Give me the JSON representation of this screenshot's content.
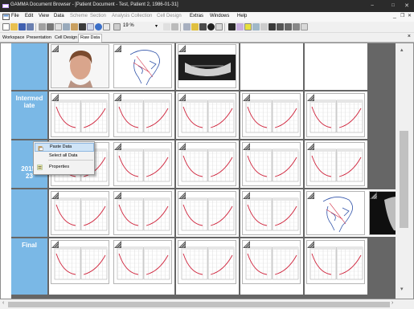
{
  "window": {
    "title": "GAMMA Document Browser - [Patient Document - Test, Patient 2, 1986-01-31]",
    "minimize": "−",
    "maximize": "□",
    "close": "✕"
  },
  "menu": {
    "items": [
      {
        "label": "File",
        "enabled": true
      },
      {
        "label": "Edit",
        "enabled": true
      },
      {
        "label": "View",
        "enabled": true
      },
      {
        "label": "Data",
        "enabled": true
      },
      {
        "label": "Scheme",
        "enabled": false
      },
      {
        "label": "Section",
        "enabled": false
      },
      {
        "label": "Analysis Collection",
        "enabled": false
      },
      {
        "label": "Cell Design",
        "enabled": false
      },
      {
        "label": "Extras",
        "enabled": true
      },
      {
        "label": "Windows",
        "enabled": true
      },
      {
        "label": "Help",
        "enabled": true
      }
    ],
    "doc_minimize": "_",
    "doc_restore": "❐",
    "doc_close": "✕"
  },
  "toolbar": {
    "zoom_value": "19 %",
    "zoom_dropdown": "▾"
  },
  "tabs": [
    {
      "label": "Workspace",
      "active": false
    },
    {
      "label": "Presentation",
      "active": false
    },
    {
      "label": "Cell Design",
      "active": false
    },
    {
      "label": "Raw Data",
      "active": true
    }
  ],
  "tab_close": "×",
  "rows": [
    {
      "label": "",
      "thumbs": [
        "photo-face",
        "ceph-tracing",
        "xray-pano"
      ]
    },
    {
      "label": "Intermed\niate",
      "thumbs": [
        "chart",
        "chart",
        "chart",
        "chart",
        "chart"
      ]
    },
    {
      "label": "2015-\n23",
      "thumbs": [
        "chart",
        "chart",
        "chart",
        "chart",
        "chart"
      ]
    },
    {
      "label": "",
      "thumbs": [
        "chart",
        "chart",
        "chart",
        "chart",
        "ceph-tracing",
        "xray-ceph"
      ]
    },
    {
      "label": "Final",
      "thumbs": [
        "chart",
        "chart",
        "chart",
        "chart",
        "chart"
      ]
    }
  ],
  "context_menu": {
    "items": [
      {
        "label": "Paste Data",
        "icon": "paste-icon",
        "highlighted": true
      },
      {
        "label": "Select all Data",
        "icon": "",
        "highlighted": false
      },
      {
        "label": "Properties",
        "icon": "properties-icon",
        "highlighted": false
      }
    ]
  },
  "scrollbars": {
    "up": "▴",
    "down": "▾",
    "left": "‹",
    "right": "›"
  },
  "colors": {
    "row_label_bg": "#7ab8e6",
    "titlebar_bg": "#2b2b2b",
    "chart_line": "#d0243c",
    "context_highlight": "#cfe4f7"
  }
}
